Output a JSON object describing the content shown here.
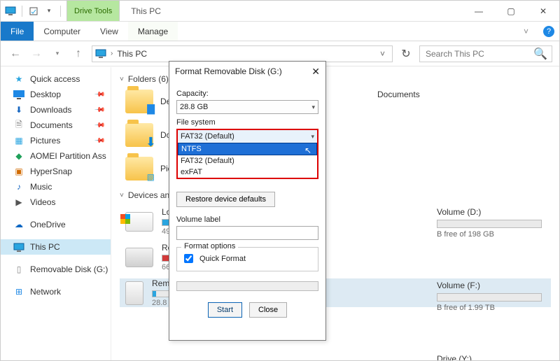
{
  "window": {
    "title": "This PC",
    "ctx_tab_group": "Drive Tools",
    "min": "—",
    "max": "▢",
    "close": "✕"
  },
  "ribbon": {
    "file": "File",
    "computer": "Computer",
    "view": "View",
    "manage": "Manage"
  },
  "address": {
    "location": "This PC",
    "search_placeholder": "Search This PC"
  },
  "nav": {
    "quick": "Quick access",
    "desktop": "Desktop",
    "downloads": "Downloads",
    "documents": "Documents",
    "pictures": "Pictures",
    "aomei": "AOMEI Partition Ass",
    "hypersnap": "HyperSnap",
    "music": "Music",
    "videos": "Videos",
    "onedrive": "OneDrive",
    "thispc": "This PC",
    "removable": "Removable Disk (G:)",
    "network": "Network"
  },
  "content": {
    "folders_header": "Folders (6)",
    "desktop": "Desktop",
    "downloads": "Downloads",
    "pictures": "Pictures",
    "documents": "Documents",
    "devices_header": "Devices and drives",
    "drives": [
      {
        "name": "Local Disk",
        "sub": "490 GB free"
      },
      {
        "name": "Recovery",
        "sub": "66.8 MB free"
      },
      {
        "name": "Removable",
        "sub": "28.8 GB free"
      }
    ],
    "right": {
      "vol_d": "Volume (D:)",
      "d_free": "B free of 198 GB",
      "vol_f": "Volume (F:)",
      "f_free": "B free of 1.99 TB",
      "drive_y": "Drive (Y:)"
    }
  },
  "dialog": {
    "title": "Format Removable Disk (G:)",
    "capacity_label": "Capacity:",
    "capacity_value": "28.8 GB",
    "fs_label": "File system",
    "fs_selected": "FAT32 (Default)",
    "fs_options": {
      "ntfs": "NTFS",
      "fat32": "FAT32 (Default)",
      "exfat": "exFAT"
    },
    "restore": "Restore device defaults",
    "volume_label": "Volume label",
    "format_options": "Format options",
    "quick_format": "Quick Format",
    "start": "Start",
    "close": "Close"
  }
}
